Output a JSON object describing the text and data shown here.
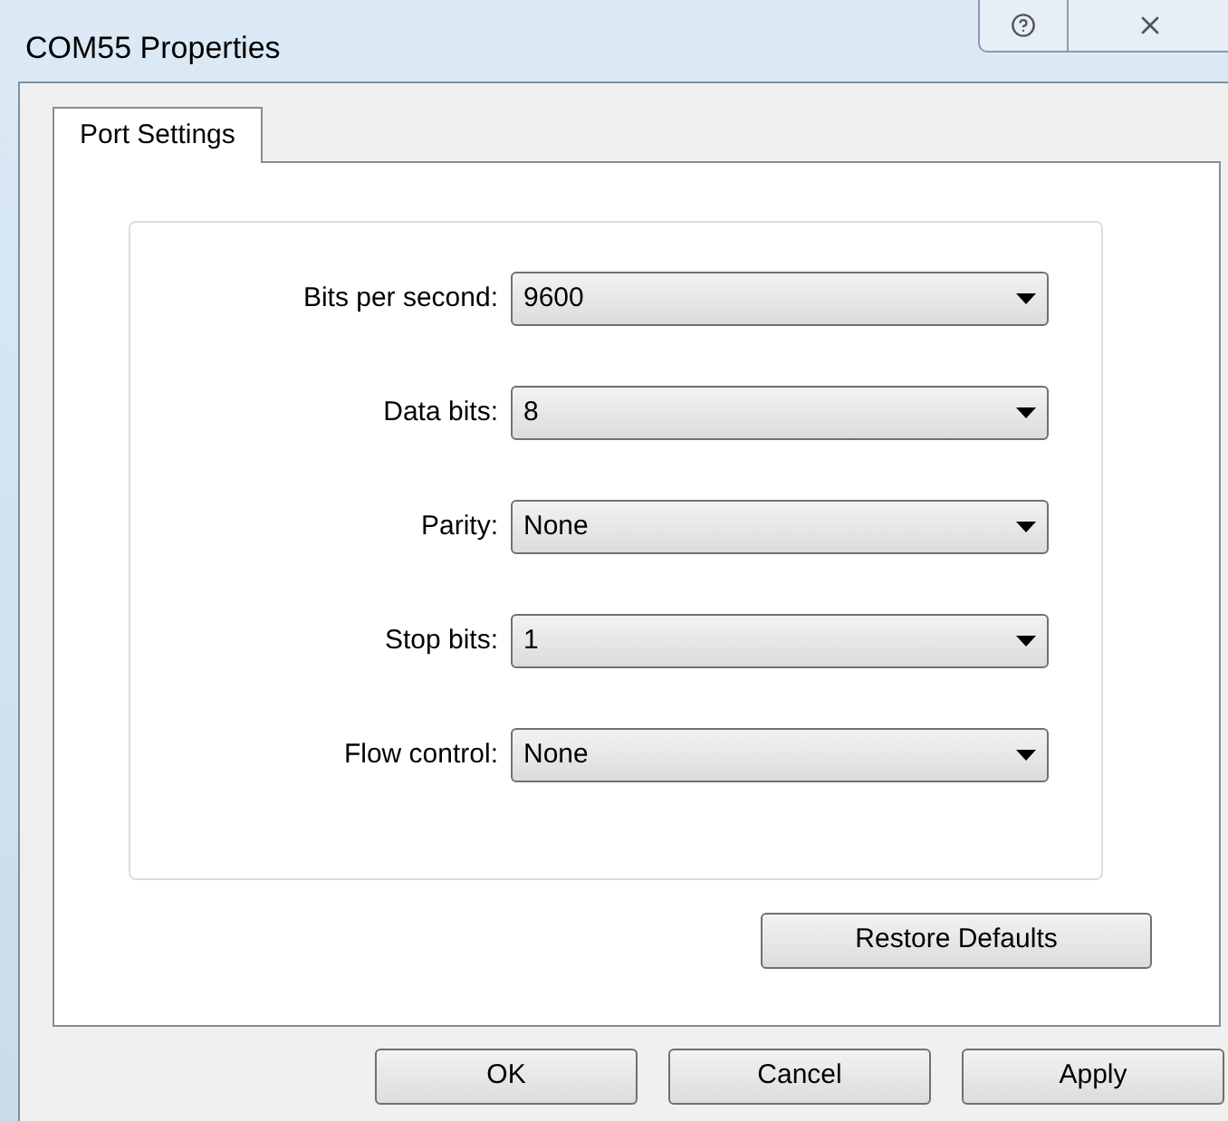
{
  "window": {
    "title": "COM55 Properties"
  },
  "tabs": [
    {
      "label": "Port Settings",
      "selected": true
    }
  ],
  "settings": [
    {
      "label": "Bits per second:",
      "value": "9600"
    },
    {
      "label": "Data bits:",
      "value": "8"
    },
    {
      "label": "Parity:",
      "value": "None"
    },
    {
      "label": "Stop bits:",
      "value": "1"
    },
    {
      "label": "Flow control:",
      "value": "None"
    }
  ],
  "restore_button": "Restore Defaults",
  "buttons": [
    "OK",
    "Cancel",
    "Apply"
  ]
}
